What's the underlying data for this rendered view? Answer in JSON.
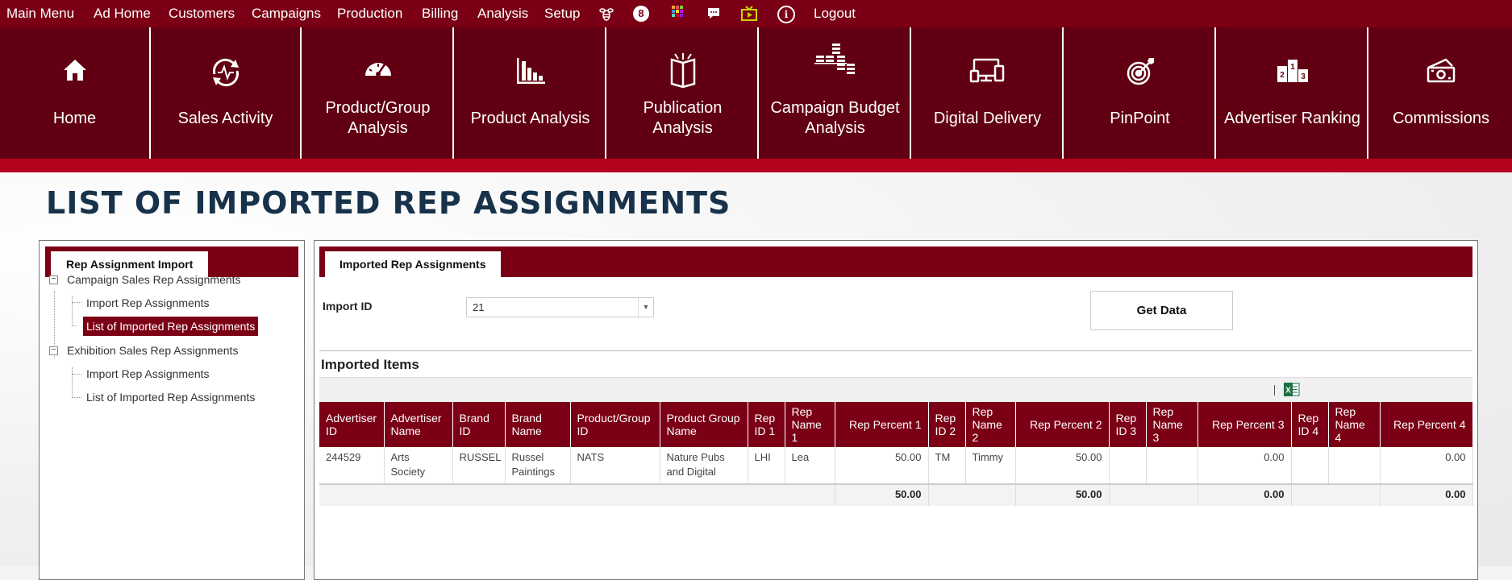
{
  "menu": {
    "items": [
      "Main Menu",
      "Ad Home",
      "Customers",
      "Campaigns",
      "Production",
      "Billing",
      "Analysis",
      "Setup"
    ],
    "badge_count": "8",
    "info_symbol": "i",
    "logout": "Logout",
    "icons": [
      "bee-icon",
      "notification-badge",
      "apps-grid-icon",
      "chat-icon",
      "media-icon",
      "info-icon"
    ]
  },
  "tiles": [
    {
      "label": "Home",
      "icon": "home-icon"
    },
    {
      "label": "Sales Activity",
      "icon": "sales-activity-icon"
    },
    {
      "label": "Product/Group Analysis",
      "icon": "gauge-icon"
    },
    {
      "label": "Product Analysis",
      "icon": "bar-chart-icon"
    },
    {
      "label": "Publication Analysis",
      "icon": "open-book-icon"
    },
    {
      "label": "Campaign Budget Analysis",
      "icon": "coin-stacks-icon"
    },
    {
      "label": "Digital Delivery",
      "icon": "devices-icon"
    },
    {
      "label": "PinPoint",
      "icon": "target-icon"
    },
    {
      "label": "Advertiser Ranking",
      "icon": "podium-icon"
    },
    {
      "label": "Commissions",
      "icon": "cash-icon"
    }
  ],
  "page_title": "LIST OF IMPORTED REP ASSIGNMENTS",
  "left_panel": {
    "tab": "Rep Assignment Import",
    "tree": [
      {
        "label": "Campaign Sales Rep Assignments",
        "children": [
          "Import Rep Assignments",
          "List of Imported Rep Assignments"
        ]
      },
      {
        "label": "Exhibition Sales Rep Assignments",
        "children": [
          "Import Rep Assignments",
          "List of Imported Rep Assignments"
        ]
      }
    ],
    "selected": "Campaign Sales Rep Assignments / List of Imported Rep Assignments"
  },
  "right_panel": {
    "tab": "Imported Rep Assignments",
    "import_id_label": "Import ID",
    "import_id_value": "21",
    "get_data_label": "Get Data",
    "section_title": "Imported Items",
    "export_icon": "excel-export-icon",
    "columns": [
      "Advertiser ID",
      "Advertiser Name",
      "Brand ID",
      "Brand Name",
      "Product/Group ID",
      "Product Group Name",
      "Rep ID 1",
      "Rep Name 1",
      "Rep Percent 1",
      "Rep ID 2",
      "Rep Name 2",
      "Rep Percent 2",
      "Rep ID 3",
      "Rep Name 3",
      "Rep Percent 3",
      "Rep ID 4",
      "Rep Name 4",
      "Rep Percent 4"
    ],
    "rows": [
      [
        "244529",
        "Arts Society",
        "RUSSEL",
        "Russel Paintings",
        "NATS",
        "Nature Pubs and Digital",
        "LHI",
        "Lea",
        "50.00",
        "TM",
        "Timmy",
        "50.00",
        "",
        "",
        "0.00",
        "",
        "",
        "0.00"
      ]
    ],
    "totals": {
      "rep_percent_1": "50.00",
      "rep_percent_2": "50.00",
      "rep_percent_3": "0.00",
      "rep_percent_4": "0.00"
    }
  },
  "colors": {
    "brand": "#7b0015",
    "tile": "#610012",
    "accent": "#b5001e",
    "title": "#17324a"
  }
}
